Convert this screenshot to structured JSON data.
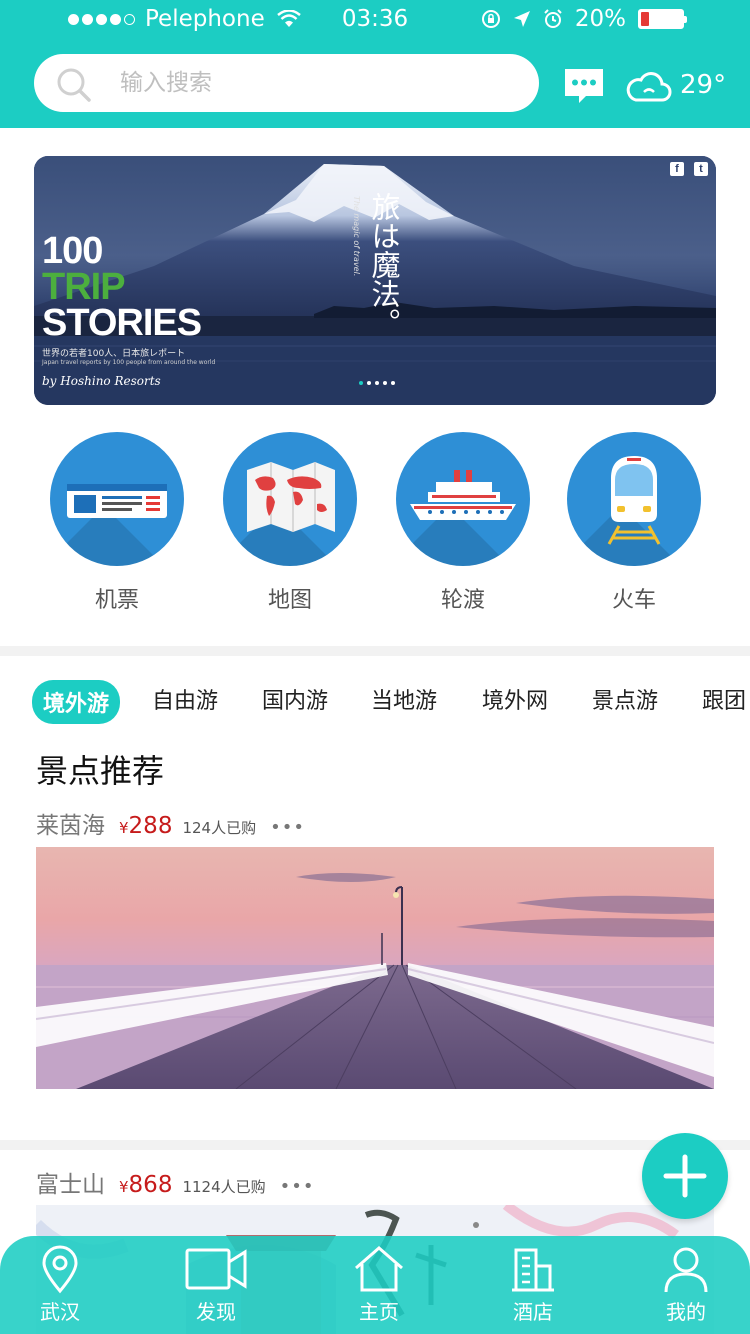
{
  "status_bar": {
    "carrier": "Pelephone",
    "time": "03:36",
    "battery": "20%",
    "battery_level": 0.2
  },
  "search": {
    "placeholder": "输入搜索"
  },
  "weather": {
    "temperature": "29°"
  },
  "banner": {
    "line1": "100",
    "line2": "TRIP",
    "line3": "STORIES",
    "subtitle": "世界の若者100人、日本旅レポート",
    "subtitle_en": "Japan travel reports by 100 people from around the world",
    "signature": "by Hoshino Resorts",
    "vertical_title": "旅は魔法。",
    "vertical_small": "The magic of travel.",
    "social": [
      "f",
      "t"
    ],
    "pager_count": 5,
    "pager_active": 0
  },
  "categories": [
    {
      "label": "机票",
      "icon": "flight-ticket-icon"
    },
    {
      "label": "地图",
      "icon": "world-map-icon"
    },
    {
      "label": "轮渡",
      "icon": "ferry-ship-icon"
    },
    {
      "label": "火车",
      "icon": "train-icon"
    }
  ],
  "tabs": [
    "境外游",
    "自由游",
    "国内游",
    "当地游",
    "境外网",
    "景点游",
    "跟团"
  ],
  "active_tab": "境外游",
  "section_title": "景点推荐",
  "items": [
    {
      "name": "莱茵海",
      "currency": "¥",
      "price": "288",
      "sold": "124人已购",
      "more": "•••"
    },
    {
      "name": "富士山",
      "currency": "¥",
      "price": "868",
      "sold": "1124人已购",
      "more": "•••"
    }
  ],
  "tabbar": [
    {
      "label": "武汉",
      "icon": "location-pin-icon"
    },
    {
      "label": "发现",
      "icon": "video-camera-icon"
    },
    {
      "label": "主页",
      "icon": "home-icon"
    },
    {
      "label": "酒店",
      "icon": "hotel-building-icon"
    },
    {
      "label": "我的",
      "icon": "person-icon"
    }
  ],
  "colors": {
    "accent": "#1ccdc3",
    "price": "#c61b1b",
    "category_circle": "#2e8fd6"
  }
}
